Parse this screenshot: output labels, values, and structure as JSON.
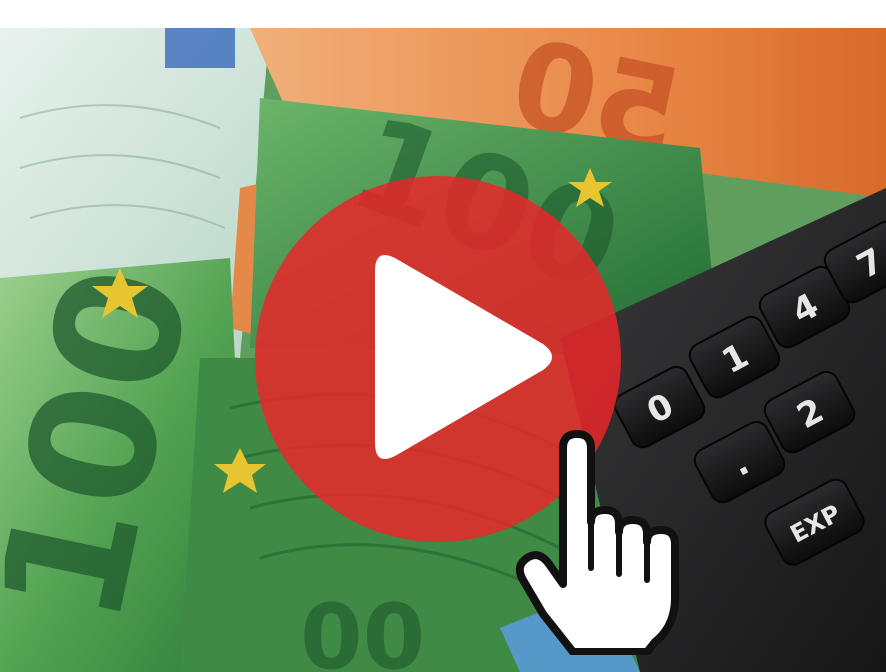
{
  "banknotes": [
    {
      "denomination": "100",
      "color": "#4c9a46"
    },
    {
      "denomination": "50",
      "color": "#e07a3a"
    }
  ],
  "calculator_keys": [
    "0",
    "1",
    "2",
    "4",
    "7",
    "EXP"
  ],
  "play_button": {
    "icon": "play-icon",
    "color": "#e8262a"
  },
  "cursor": {
    "icon": "hand-pointer-icon"
  }
}
